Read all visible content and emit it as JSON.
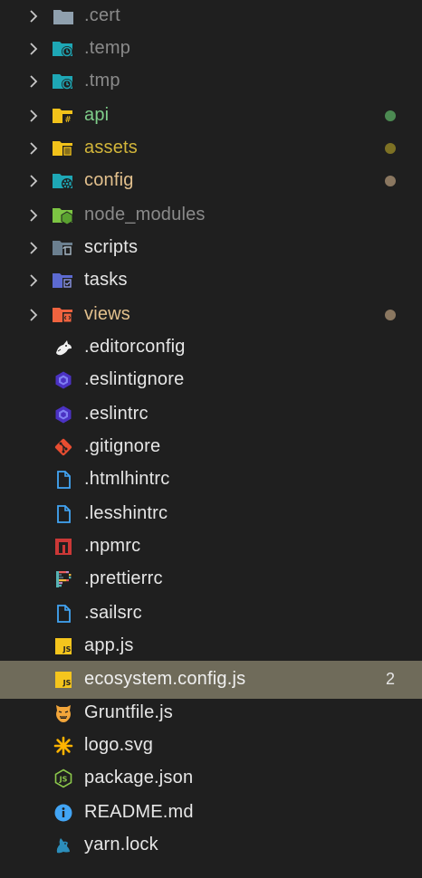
{
  "explorer": {
    "folders": [
      {
        "label": ".cert",
        "color": "#8a8a8a",
        "icon": "folder-icon",
        "icon_color": "#8fa0ae"
      },
      {
        "label": ".temp",
        "color": "#8a8a8a",
        "icon": "folder-temp-icon",
        "icon_color": "#1ea7b5"
      },
      {
        "label": ".tmp",
        "color": "#8a8a8a",
        "icon": "folder-temp-icon",
        "icon_color": "#1ea7b5"
      },
      {
        "label": "api",
        "color": "#7fce8a",
        "icon": "folder-api-icon",
        "icon_color": "#f2c21a",
        "dot_color": "#4c8a52"
      },
      {
        "label": "assets",
        "color": "#d2b53a",
        "icon": "folder-assets-icon",
        "icon_color": "#f2c21a",
        "dot_color": "#7d7124"
      },
      {
        "label": "config",
        "color": "#e2c08d",
        "icon": "folder-config-icon",
        "icon_color": "#1ea7b5",
        "dot_color": "#8a7760"
      },
      {
        "label": "node_modules",
        "color": "#8a8a8a",
        "icon": "folder-node-icon",
        "icon_color": "#7cc443"
      },
      {
        "label": "scripts",
        "color": "#e6e6e6",
        "icon": "folder-scripts-icon",
        "icon_color": "#6b7f8f"
      },
      {
        "label": "tasks",
        "color": "#e6e6e6",
        "icon": "folder-tasks-icon",
        "icon_color": "#5c6ad1"
      },
      {
        "label": "views",
        "color": "#e2c08d",
        "icon": "folder-views-icon",
        "icon_color": "#f0633f",
        "dot_color": "#8a7760"
      }
    ],
    "files": [
      {
        "label": ".editorconfig",
        "icon": "editorconfig-icon"
      },
      {
        "label": ".eslintignore",
        "icon": "eslint-icon"
      },
      {
        "label": ".eslintrc",
        "icon": "eslint-icon"
      },
      {
        "label": ".gitignore",
        "icon": "git-icon"
      },
      {
        "label": ".htmlhintrc",
        "icon": "file-icon"
      },
      {
        "label": ".lesshintrc",
        "icon": "file-icon"
      },
      {
        "label": ".npmrc",
        "icon": "npm-icon"
      },
      {
        "label": ".prettierrc",
        "icon": "prettier-icon"
      },
      {
        "label": ".sailsrc",
        "icon": "file-icon"
      },
      {
        "label": "app.js",
        "icon": "javascript-icon"
      },
      {
        "label": "ecosystem.config.js",
        "icon": "javascript-icon",
        "badge": "2",
        "selected": true
      },
      {
        "label": "Gruntfile.js",
        "icon": "grunt-icon"
      },
      {
        "label": "logo.svg",
        "icon": "svg-icon"
      },
      {
        "label": "package.json",
        "icon": "nodejs-icon"
      },
      {
        "label": "README.md",
        "icon": "info-icon"
      },
      {
        "label": "yarn.lock",
        "icon": "yarn-icon"
      }
    ]
  },
  "colors": {
    "background": "#1f1f1f",
    "selected_row": "#6f6b5a",
    "file_text": "#e6e6e6",
    "chevron": "#c8c8c8"
  }
}
